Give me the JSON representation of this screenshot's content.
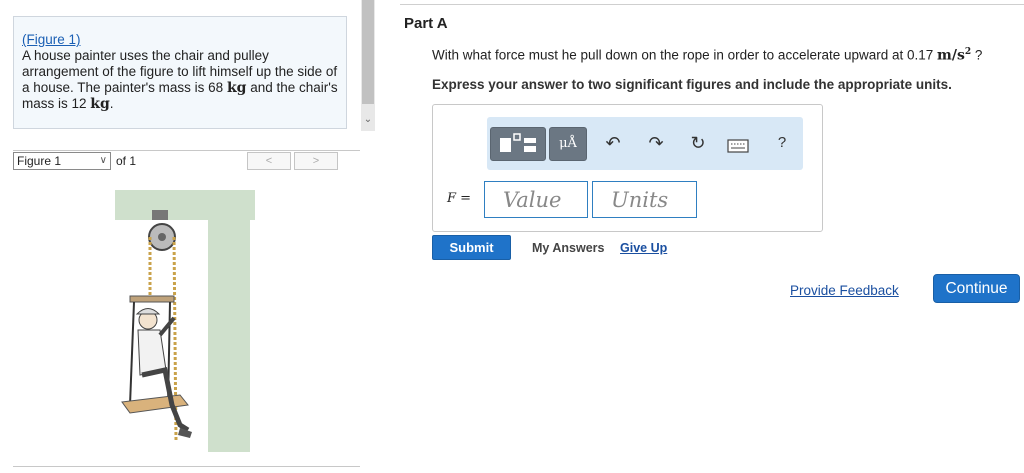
{
  "problem": {
    "figure_link": "(Figure 1)",
    "text_1": "A house painter uses the chair and pulley arrangement of the figure to lift himself up the side of a house. The painter's mass is 68 ",
    "unit_1": "kg",
    "text_2": " and the chair's mass is 12 ",
    "unit_2": "kg",
    "text_3": "."
  },
  "figure_nav": {
    "selected": "Figure 1",
    "of_label": "of 1",
    "prev_label": "<",
    "next_label": ">"
  },
  "part": {
    "title": "Part A",
    "question_prefix": "With what force must he pull down on the rope in order to accelerate upward at 0.17 ",
    "question_unit": "m/s",
    "question_exp": "2",
    "question_suffix": " ?",
    "instruction": "Express your answer to two significant figures and include the appropriate units."
  },
  "toolbar": {
    "unit_button_label": "μÅ",
    "help_label": "?",
    "icons": [
      "templates-icon",
      "units-icon",
      "undo-icon",
      "redo-icon",
      "reset-icon",
      "keyboard-icon",
      "help-icon"
    ]
  },
  "answer": {
    "variable_label": "F =",
    "value_placeholder": "Value",
    "units_placeholder": "Units"
  },
  "actions": {
    "submit_label": "Submit",
    "my_answers_label": "My Answers",
    "give_up_label": "Give Up",
    "feedback_label": "Provide Feedback",
    "continue_label": "Continue"
  },
  "colors": {
    "accent": "#1f73c9",
    "toolbar_bg": "#d8e8f6",
    "problem_bg": "#f3f8fc"
  }
}
